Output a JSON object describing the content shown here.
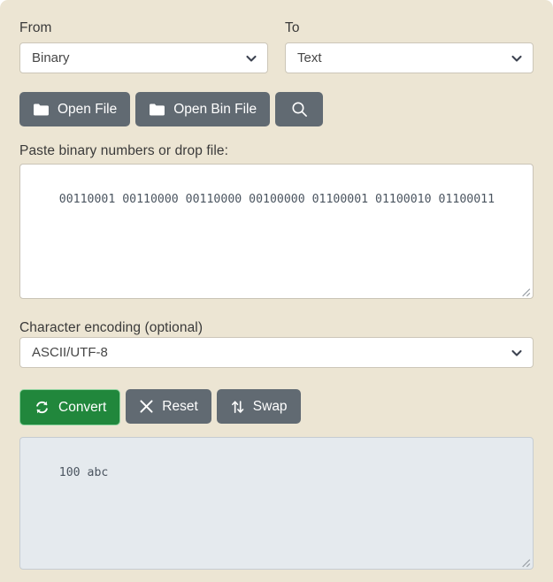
{
  "converter": {
    "from": {
      "label": "From",
      "value": "Binary"
    },
    "to": {
      "label": "To",
      "value": "Text"
    },
    "file_buttons": [
      {
        "label": "Open File",
        "icon": "folder-icon"
      },
      {
        "label": "Open Bin File",
        "icon": "folder-icon"
      },
      {
        "label": "",
        "icon": "search-icon"
      }
    ],
    "input": {
      "label": "Paste binary numbers or drop file:",
      "value": "00110001 00110000 00110000 00100000 01100001 01100010 01100011"
    },
    "encoding": {
      "label": "Character encoding (optional)",
      "value": "ASCII/UTF-8"
    },
    "actions": [
      {
        "label": "Convert",
        "icon": "refresh-icon",
        "style": "primary"
      },
      {
        "label": "Reset",
        "icon": "close-icon",
        "style": "secondary"
      },
      {
        "label": "Swap",
        "icon": "swap-arrows-icon",
        "style": "secondary"
      }
    ],
    "output": {
      "value": "100 abc"
    },
    "colors": {
      "page_background": "#ece5d3",
      "button": "#616a72",
      "primary_button": "#21873c",
      "output_background": "#e5eaee",
      "text": "#3a3a3a"
    }
  }
}
